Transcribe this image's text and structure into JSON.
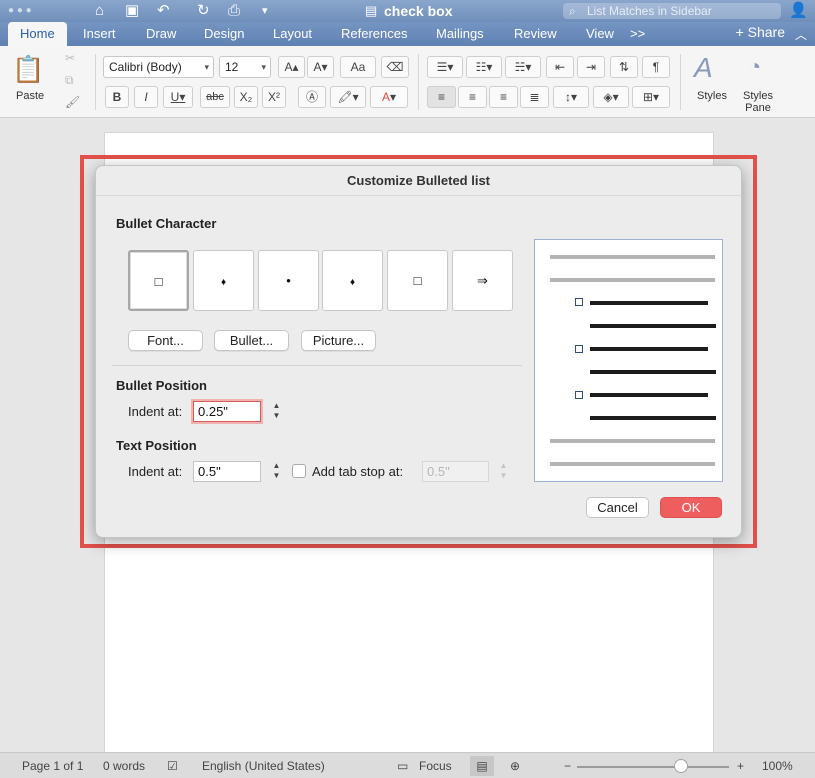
{
  "window": {
    "title": "check box",
    "search_placeholder": "List Matches in Sidebar"
  },
  "tabs": [
    {
      "label": "Home",
      "active": true
    },
    {
      "label": "Insert"
    },
    {
      "label": "Draw"
    },
    {
      "label": "Design"
    },
    {
      "label": "Layout"
    },
    {
      "label": "References"
    },
    {
      "label": "Mailings"
    },
    {
      "label": "Review"
    },
    {
      "label": "View"
    },
    {
      "label": ">>"
    }
  ],
  "share_label": "Share",
  "ribbon": {
    "paste_label": "Paste",
    "font_name": "Calibri (Body)",
    "font_size": "12",
    "styles_label": "Styles",
    "styles_pane_label": "Styles\nPane",
    "bold": "B",
    "italic": "I",
    "underline": "U",
    "strike": "abc",
    "subscript": "X₂",
    "superscript": "X²",
    "grow": "A",
    "shrink": "A",
    "change_case": "Aa",
    "font_color": "A",
    "pilcrow": "¶"
  },
  "dialog": {
    "title": "Customize Bulleted list",
    "bullet_character_title": "Bullet Character",
    "bullets": [
      "□",
      "♦",
      "•",
      "♦",
      "□",
      "⇒"
    ],
    "font_button": "Font...",
    "bullet_button": "Bullet...",
    "picture_button": "Picture...",
    "bullet_position_title": "Bullet Position",
    "bullet_indent_label": "Indent at:",
    "bullet_indent_value": "0.25\"",
    "text_position_title": "Text Position",
    "text_indent_label": "Indent at:",
    "text_indent_value": "0.5\"",
    "tab_stop_label": "Add tab stop at:",
    "tab_stop_value": "0.5\"",
    "cancel_label": "Cancel",
    "ok_label": "OK"
  },
  "status": {
    "page": "Page 1 of 1",
    "words": "0 words",
    "language": "English (United States)",
    "focus": "Focus",
    "zoom": "100%"
  },
  "colors": {
    "ok_button": "#ef5e5e",
    "highlight_outline": "#e2514b",
    "title_bar": "#6f8fbb"
  }
}
